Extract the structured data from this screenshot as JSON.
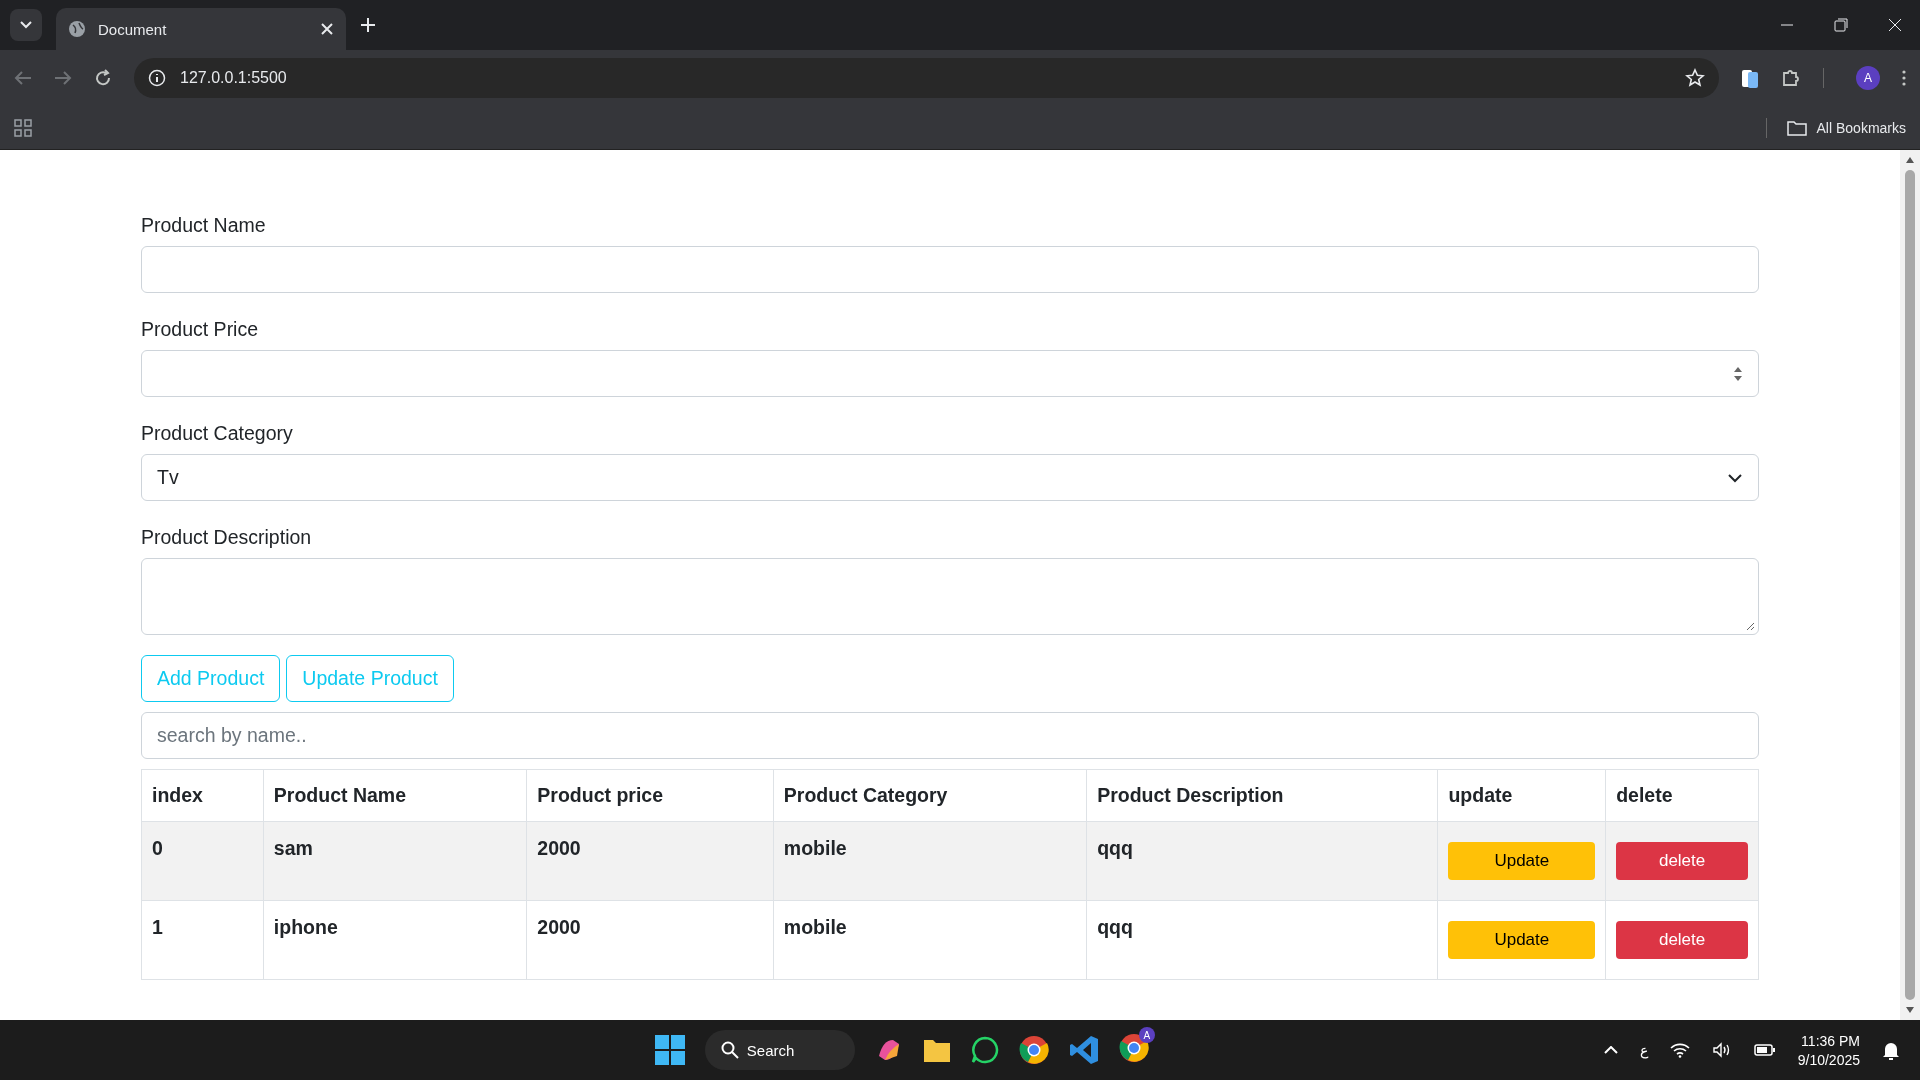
{
  "browser": {
    "tab_title": "Document",
    "address": "127.0.0.1:5500",
    "profile_letter": "A",
    "bookmarks_label": "All Bookmarks"
  },
  "form": {
    "fields": [
      {
        "kind": "text",
        "label": "Product Name"
      },
      {
        "kind": "number",
        "label": "Product Price"
      },
      {
        "kind": "select",
        "label": "Product Category",
        "value": "Tv"
      },
      {
        "kind": "textarea",
        "label": "Product Description"
      }
    ],
    "buttons": [
      "Add Product",
      "Update Product"
    ],
    "search": {
      "placeholder": "search by name.."
    }
  },
  "table": {
    "columns": [
      "index",
      "Product Name",
      "Product price",
      "Product Category",
      "Product Description",
      "update",
      "delete"
    ],
    "rows": [
      {
        "cells": [
          "0",
          "sam",
          "2000",
          "mobile",
          "qqq"
        ],
        "update_label": "Update",
        "delete_label": "delete"
      },
      {
        "cells": [
          "1",
          "iphone",
          "2000",
          "mobile",
          "qqq"
        ],
        "update_label": "Update",
        "delete_label": "delete"
      }
    ]
  },
  "taskbar": {
    "search_label": "Search",
    "chrome_badge": "A",
    "language": "ع",
    "time": "11:36 PM",
    "date": "9/10/2025"
  }
}
